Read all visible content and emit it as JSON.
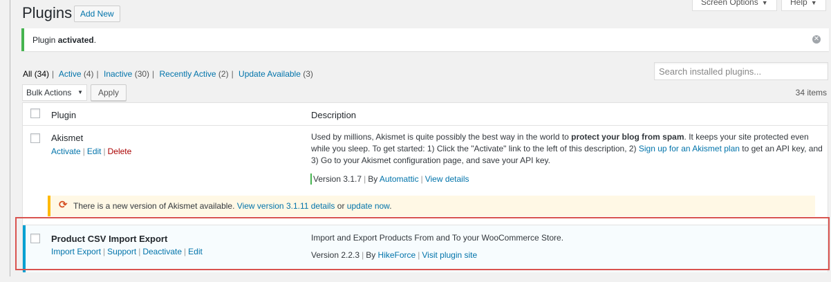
{
  "header": {
    "title": "Plugins",
    "add_new": "Add New",
    "screen_options": "Screen Options",
    "help": "Help"
  },
  "notice": {
    "prefix": "Plugin ",
    "bold": "activated",
    "suffix": ".",
    "dismiss_icon": "close-circle-icon"
  },
  "filters": {
    "all": "All",
    "all_count": "(34)",
    "active": "Active",
    "active_count": "(4)",
    "inactive": "Inactive",
    "inactive_count": "(30)",
    "recently_active": "Recently Active",
    "recently_active_count": "(2)",
    "update_available": "Update Available",
    "update_available_count": "(3)"
  },
  "search": {
    "placeholder": "Search installed plugins..."
  },
  "bulk": {
    "selected": "Bulk Actions",
    "apply": "Apply"
  },
  "items_count": "34 items",
  "table": {
    "col_plugin": "Plugin",
    "col_description": "Description"
  },
  "rows": [
    {
      "name": "Akismet",
      "actions": [
        "Activate",
        "Edit",
        "Delete"
      ],
      "desc_1": "Used by millions, Akismet is quite possibly the best way in the world to ",
      "desc_bold": "protect your blog from spam",
      "desc_2": ". It keeps your site protected even while you sleep. To get started: 1) Click the \"Activate\" link to the left of this description, 2) ",
      "desc_link": "Sign up for an Akismet plan",
      "desc_3": " to get an API key, and 3) Go to your Akismet configuration page, and save your API key.",
      "version": "Version 3.1.7",
      "by": "By",
      "author": "Automattic",
      "details": "View details",
      "update": {
        "text": "There is a new version of Akismet available.",
        "view_link": "View version 3.1.11 details",
        "or": "or",
        "update_link": "update now",
        "end": "."
      }
    },
    {
      "name": "Product CSV Import Export",
      "actions": [
        "Import Export",
        "Support",
        "Deactivate",
        "Edit"
      ],
      "description": "Import and Export Products From and To your WooCommerce Store.",
      "version": "Version 2.2.3",
      "by": "By",
      "author": "HikeForce",
      "details": "Visit plugin site"
    }
  ],
  "colors": {
    "link": "#0073aa",
    "active_border": "#00a0d2",
    "success": "#46b450",
    "warning": "#ffb900",
    "highlight": "#d9534f"
  }
}
